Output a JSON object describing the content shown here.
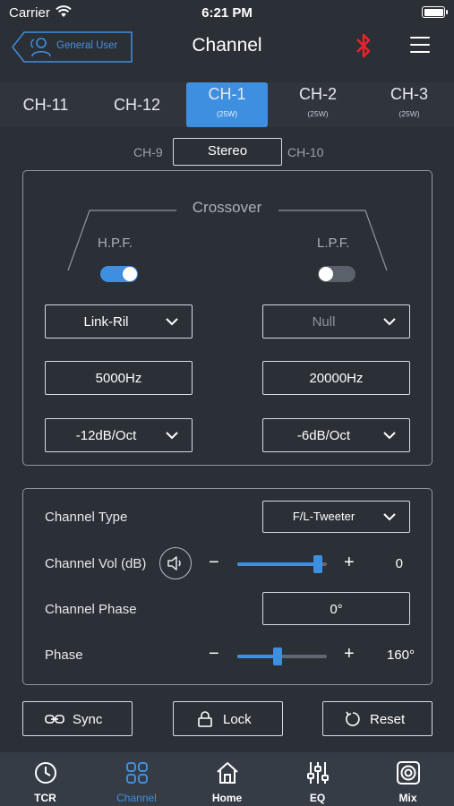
{
  "status_bar": {
    "carrier": "Carrier",
    "time": "6:21 PM"
  },
  "nav": {
    "user_label": "General User",
    "title": "Channel"
  },
  "channel_tabs": [
    {
      "name": "CH-11",
      "power": ""
    },
    {
      "name": "CH-12",
      "power": ""
    },
    {
      "name": "CH-1",
      "power": "(25W)"
    },
    {
      "name": "CH-2",
      "power": "(25W)"
    },
    {
      "name": "CH-3",
      "power": "(25W)"
    }
  ],
  "active_channel": "CH-1",
  "link": {
    "left": "CH-9",
    "mode": "Stereo",
    "right": "CH-10"
  },
  "crossover": {
    "title": "Crossover",
    "hpf": {
      "label": "H.P.F.",
      "enabled": true,
      "type": "Link-Ril",
      "freq": "5000Hz",
      "slope": "-12dB/Oct"
    },
    "lpf": {
      "label": "L.P.F.",
      "enabled": false,
      "type": "Null",
      "freq": "20000Hz",
      "slope": "-6dB/Oct"
    }
  },
  "settings": {
    "channel_type_label": "Channel Type",
    "channel_type_value": "F/L-Tweeter",
    "channel_vol_label": "Channel Vol (dB)",
    "channel_vol_value": "0",
    "channel_vol_level": 0.9,
    "channel_phase_label": "Channel Phase",
    "channel_phase_value": "0°",
    "phase_label": "Phase",
    "phase_value": "160°",
    "phase_level": 0.45,
    "minus": "−",
    "plus": "+"
  },
  "actions": {
    "sync": "Sync",
    "lock": "Lock",
    "reset": "Reset"
  },
  "tab_bar": [
    {
      "label": "TCR",
      "icon": "clock-icon"
    },
    {
      "label": "Channel",
      "icon": "grid-icon"
    },
    {
      "label": "Home",
      "icon": "home-icon"
    },
    {
      "label": "EQ",
      "icon": "equalizer-icon"
    },
    {
      "label": "Mix",
      "icon": "speaker-icon"
    }
  ],
  "colors": {
    "accent": "#3f8fe0",
    "bluetooth": "#e8232a",
    "background": "#2b2f36"
  }
}
